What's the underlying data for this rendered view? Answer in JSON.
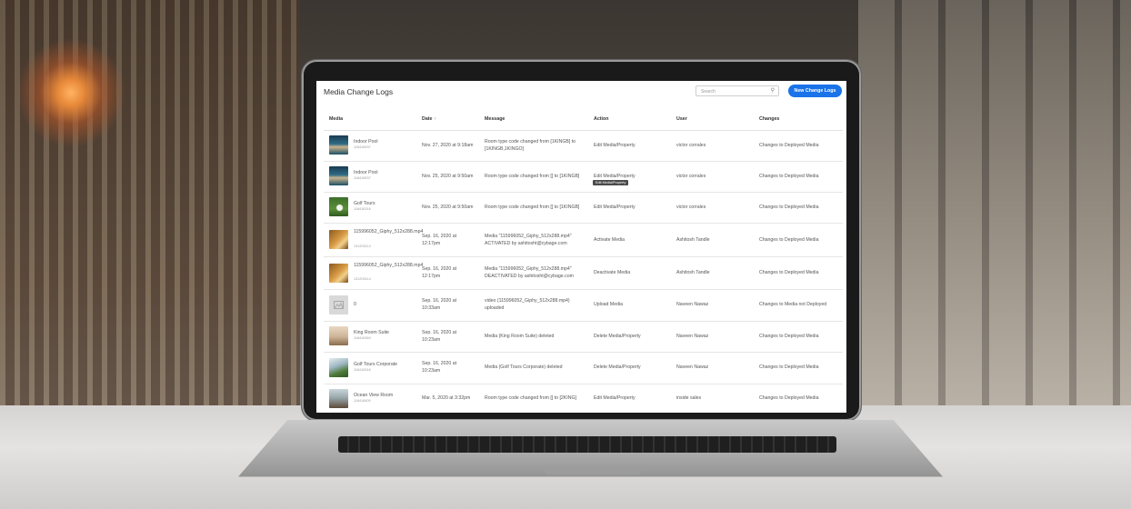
{
  "page": {
    "title": "Media Change Logs",
    "search_placeholder": "Search",
    "new_button_label": "New Change Logs"
  },
  "columns": [
    "Media",
    "Date",
    "Message",
    "Action",
    "User",
    "Changes"
  ],
  "tooltip": "Edit Media/Property",
  "rows": [
    {
      "media_name": "Indoor Pool",
      "media_id": "116416537",
      "date": "Nov. 27, 2020 at 9:18am",
      "message": "Room type code changed from [1KINGB] to [1KINGB,1KINGO]",
      "action": "Edit Media/Property",
      "user": "victor corrales",
      "changes": "Changes to Deployed Media",
      "thumb": "pool-thumbnail"
    },
    {
      "media_name": "Indoor Pool",
      "media_id": "116416537",
      "date": "Nov. 25, 2020 at 9:50am",
      "message": "Room type code changed from [] to [1KINGB]",
      "action": "Edit Media/Property",
      "user": "victor corrales",
      "changes": "Changes to Deployed Media",
      "thumb": "pool-thumbnail"
    },
    {
      "media_name": "Golf Tours",
      "media_id": "116416316",
      "date": "Nov. 25, 2020 at 9:50am",
      "message": "Room type code changed from [] to [1KINGB]",
      "action": "Edit Media/Property",
      "user": "victor corrales",
      "changes": "Changes to Deployed Media",
      "thumb": "golf-thumbnail"
    },
    {
      "media_name": "115996052_Giphy_512x288.mp4",
      "media_id": "131203114",
      "date": "Sep. 16, 2020 at 12:17pm",
      "message": "Media \"115996052_Giphy_512x288.mp4\" ACTIVATED by ashitosht@cybage.com",
      "action": "Activate Media",
      "user": "Ashitosh Tandle",
      "changes": "Changes to Deployed Media",
      "thumb": "video-thumbnail"
    },
    {
      "media_name": "115996052_Giphy_512x288.mp4",
      "media_id": "131203114",
      "date": "Sep. 16, 2020 at 12:17pm",
      "message": "Media \"115996052_Giphy_512x288.mp4\" DEACTIVATED by ashitosht@cybage.com",
      "action": "Deactivate Media",
      "user": "Ashitosh Tandle",
      "changes": "Changes to Deployed Media",
      "thumb": "video-thumbnail"
    },
    {
      "media_name": "0",
      "media_id": "",
      "date": "Sep. 16, 2020 at 10:33am",
      "message": "video (115996052_Giphy_512x288.mp4) uploaded",
      "action": "Upload Media",
      "user": "Naveen Nawaz",
      "changes": "Changes to Media not Deployed",
      "thumb": "placeholder-image"
    },
    {
      "media_name": "King Room Suite",
      "media_id": "116416369",
      "date": "Sep. 16, 2020 at 10:23am",
      "message": "Media (King Room Suite) deleted",
      "action": "Delete Media/Property",
      "user": "Naveen Nawaz",
      "changes": "Changes to Deployed Media",
      "thumb": "room-thumbnail"
    },
    {
      "media_name": "Golf Tours Corporate",
      "media_id": "116416316",
      "date": "Sep. 16, 2020 at 10:23am",
      "message": "Media (Golf Tours Corporate) deleted",
      "action": "Delete Media/Property",
      "user": "Naveen Nawaz",
      "changes": "Changes to Deployed Media",
      "thumb": "golf-corporate-thumbnail"
    },
    {
      "media_name": "Ocean View Room",
      "media_id": "116416400",
      "date": "Mar. 5, 2020 at 3:32pm",
      "message": "Room type code changed from [] to [2KING]",
      "action": "Edit Media/Property",
      "user": "inside sales",
      "changes": "Changes to Deployed Media",
      "thumb": "ocean-room-thumbnail"
    }
  ],
  "colors": {
    "accent": "#1a73e8"
  }
}
